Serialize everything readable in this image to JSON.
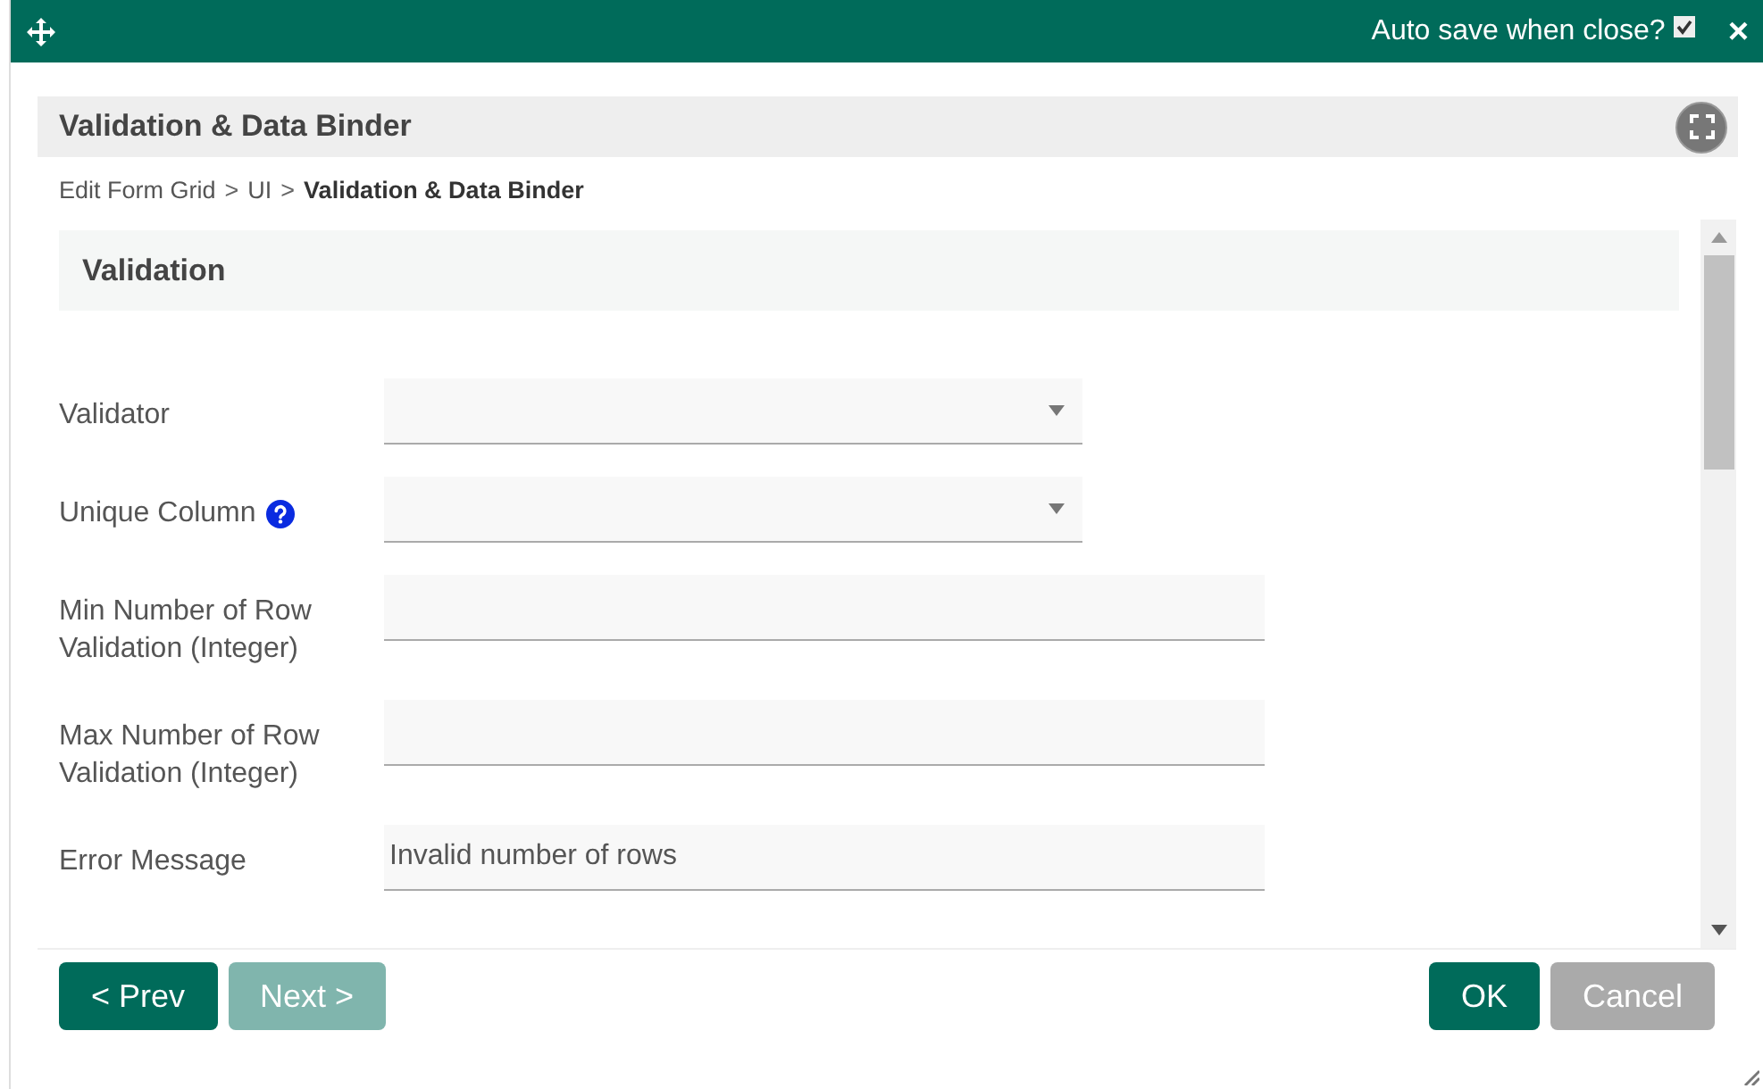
{
  "window": {
    "auto_save_label": "Auto save when close?",
    "auto_save_checked": true,
    "close": "×"
  },
  "panel": {
    "title": "Validation & Data Binder"
  },
  "breadcrumb": [
    {
      "label": "Edit Form Grid",
      "current": false
    },
    {
      "label": ">",
      "kind": "sep"
    },
    {
      "label": "UI",
      "current": false
    },
    {
      "label": ">",
      "kind": "sep"
    },
    {
      "label": "Validation & Data Binder",
      "current": true
    }
  ],
  "section": {
    "title": "Validation"
  },
  "fields": [
    {
      "kind": "select",
      "label": "Validator"
    },
    {
      "kind": "select",
      "label": "Unique Column",
      "help": true
    },
    {
      "kind": "text",
      "label": "Min Number of Row Validation (Integer)"
    },
    {
      "kind": "text",
      "label": "Max Number of Row Validation (Integer)"
    },
    {
      "kind": "text",
      "label": "Error Message",
      "value": "Invalid number of rows"
    }
  ],
  "buttons_left": [
    {
      "label": "< Prev",
      "kind": "primary",
      "disabled": false
    },
    {
      "label": "Next >",
      "kind": "primary",
      "disabled": true
    }
  ],
  "buttons_right": [
    {
      "label": "OK",
      "kind": "primary",
      "disabled": false
    },
    {
      "label": "Cancel",
      "kind": "secondary",
      "disabled": false
    }
  ]
}
